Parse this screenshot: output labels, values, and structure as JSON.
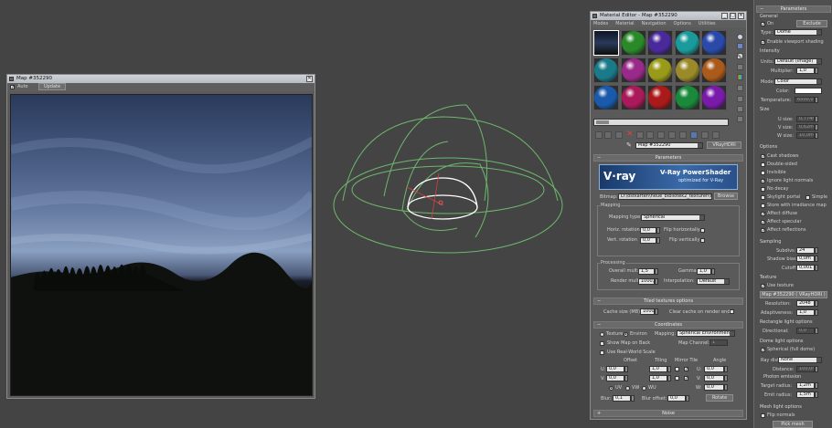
{
  "map_window": {
    "title": "Map #352290",
    "toolbar": {
      "auto_label": "Auto",
      "update_label": "Update"
    }
  },
  "material_editor": {
    "title": "Material Editor - Map #352290",
    "menu": [
      "Modes",
      "Material",
      "Navigation",
      "Options",
      "Utilities"
    ],
    "map_name": "Map #352290",
    "map_type": "VRayHDRI",
    "ball_colors": [
      "#2a8a2a",
      "#4a2a9a",
      "#1a9a9a",
      "#2a4aaa",
      "#1a7a8a",
      "#9a2a8a",
      "#9a9a1a",
      "#9a8a2a",
      "#aa5a1a",
      "#1a5aaa",
      "#aa1a5a",
      "#aa1a1a",
      "#1a8a3a",
      "#7a1aaa"
    ],
    "parameters_title": "Parameters",
    "vray_banner": {
      "logo": "V·ray",
      "title": "V-Ray PowerShader",
      "subtitle": "optimized for V-Ray"
    },
    "bitmap": {
      "label": "Bitmap:",
      "value": "D:\\ostkarten\\neue_bibliotek2_texturen\\hdri\\hd",
      "browse": "Browse"
    },
    "mapping": {
      "group": "Mapping",
      "type_label": "Mapping type:",
      "type_value": "Spherical",
      "horiz_label": "Horiz. rotation",
      "horiz_value": "0,0",
      "vert_label": "Vert. rotation",
      "vert_value": "0,0",
      "flip_h": "Flip horizontally",
      "flip_v": "Flip vertically"
    },
    "processing": {
      "group": "Processing",
      "overall_label": "Overall mult:",
      "overall_value": "1,5",
      "gamma_label": "Gamma:",
      "gamma_value": "1,0",
      "render_label": "Render mult:",
      "render_value": "1000,0",
      "interp_label": "Interpolation:",
      "interp_value": "Default"
    },
    "tiled": {
      "title": "Tiled textures options",
      "cache_label": "Cache size (MB):",
      "cache_value": "1000",
      "clear_label": "Clear cache on render end"
    },
    "coordinates": {
      "title": "Coordinates",
      "texture_label": "Texture",
      "environ_label": "Environ",
      "mapping_label": "Mapping:",
      "mapping_value": "Spherical Environment",
      "show_map": "Show Map on Back",
      "map_channel_label": "Map Channel:",
      "map_channel_value": "1",
      "real_world": "Use Real-World Scale",
      "offset": "Offset",
      "tiling": "Tiling",
      "mirror_tile": "Mirror Tile",
      "angle": "Angle",
      "u": "U:",
      "v": "V:",
      "w": "W:",
      "u_offset": "0,0",
      "v_offset": "0,0",
      "u_tiling": "1,0",
      "v_tiling": "1,0",
      "u_angle": "0,0",
      "v_angle": "0,0",
      "w_angle": "0,0",
      "uv": "UV",
      "vw": "VW",
      "wu": "WU",
      "blur_label": "Blur:",
      "blur_value": "0,1",
      "blur_offset_label": "Blur offset:",
      "blur_offset_value": "0,0",
      "rotate": "Rotate"
    },
    "noise_title": "Noise"
  },
  "right_panel": {
    "title": "Parameters",
    "general": "General",
    "on": "On",
    "exclude": "Exclude",
    "type_label": "Type:",
    "type_value": "Dome",
    "enable_viewport": "Enable viewport shading",
    "intensity": "Intensity",
    "units_label": "Units:",
    "units_value": "Default (image)",
    "multiplier_label": "Multiplier:",
    "multiplier_value": "1,0",
    "mode_label": "Mode:",
    "mode_value": "Color",
    "color_label": "Color:",
    "temperature_label": "Temperature:",
    "temperature_value": "6500,0",
    "size": "Size",
    "usize_label": "U size:",
    "usize_value": "0,774m",
    "vsize_label": "V size:",
    "vsize_value": "0,62m",
    "wsize_label": "W size:",
    "wsize_value": "10,0m",
    "options": "Options",
    "cast_shadows": "Cast shadows",
    "double_sided": "Double-sided",
    "invisible": "Invisible",
    "ignore_normals": "Ignore light normals",
    "no_decay": "No decay",
    "skylight_portal": "Skylight portal",
    "simple": "Simple",
    "store_irradiance": "Store with irradiance map",
    "affect_diffuse": "Affect diffuse",
    "affect_specular": "Affect specular",
    "affect_reflections": "Affect reflections",
    "sampling": "Sampling",
    "subdivs_label": "Subdivs:",
    "subdivs_value": "24",
    "shadow_bias_label": "Shadow bias:",
    "shadow_bias_value": "0,0m",
    "cutoff_label": "Cutoff:",
    "cutoff_value": "0,001",
    "texture": "Texture",
    "use_texture": "Use texture",
    "texture_map": "Map #352290  ( VRayHDRI )",
    "resolution_label": "Resolution:",
    "resolution_value": "2048",
    "adaptiveness_label": "Adaptiveness:",
    "adaptiveness_value": "1,0",
    "rect_options": "Rectangle light options",
    "directional_label": "Directional:",
    "directional_value": "0,0",
    "dome_options": "Dome light options",
    "spherical_full": "Spherical (full dome)",
    "ray_dist_label": "Ray dist:",
    "ray_dist_value": "None",
    "distance_label": "Distance:",
    "distance_value": "100,0m",
    "photon_emission": "Photon emission",
    "target_radius_label": "Target radius:",
    "target_radius_value": "1,2m",
    "emit_radius_label": "Emit radius:",
    "emit_radius_value": "1,5m",
    "mesh_options": "Mesh light options",
    "flip_normals": "Flip normals",
    "pick_mesh": "Pick mesh"
  }
}
